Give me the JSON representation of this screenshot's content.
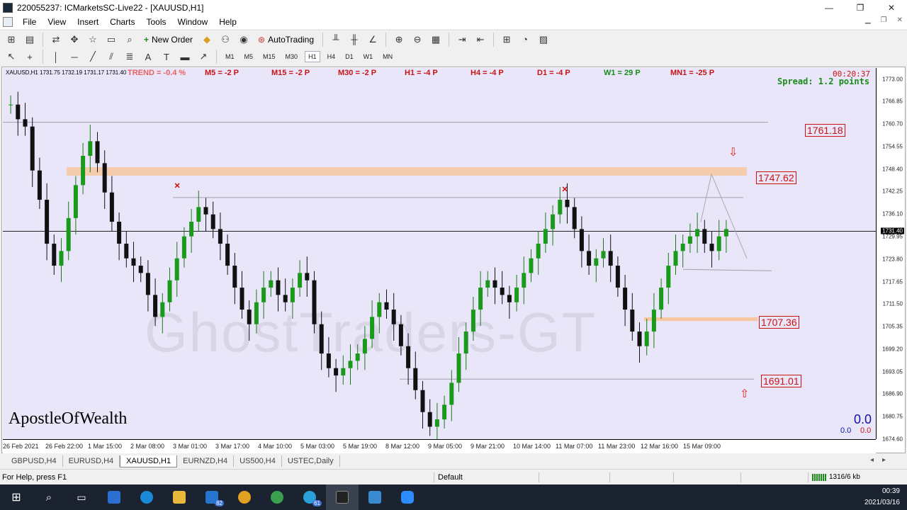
{
  "window": {
    "title": "220055237: ICMarketsSC-Live22 - [XAUUSD,H1]",
    "controls": [
      "—",
      "❐",
      "✕"
    ]
  },
  "menu": [
    "File",
    "View",
    "Insert",
    "Charts",
    "Tools",
    "Window",
    "Help"
  ],
  "toolbar": {
    "new_order": "New Order",
    "auto_trading": "AutoTrading",
    "timeframes": [
      "M1",
      "M5",
      "M15",
      "M30",
      "H1",
      "H4",
      "D1",
      "W1",
      "MN"
    ],
    "active_timeframe": "H1"
  },
  "chart": {
    "symbol_header": "XAUUSD,H1  1731.75 1732.19 1731.17 1731.40",
    "percent_info": "TREND = -0.4 %",
    "period_points": [
      {
        "label": "M5 = -2 P",
        "color": "#c81414"
      },
      {
        "label": "M15 = -2 P",
        "color": "#c81414"
      },
      {
        "label": "M30 = -2 P",
        "color": "#c81414"
      },
      {
        "label": "H1 = -4 P",
        "color": "#c81414"
      },
      {
        "label": "H4 = -4 P",
        "color": "#c81414"
      },
      {
        "label": "D1 = -4 P",
        "color": "#c81414"
      },
      {
        "label": "W1 = 29 P",
        "color": "#1a8a1a"
      },
      {
        "label": "MN1 = -25 P",
        "color": "#c81414"
      }
    ],
    "timer": "00:20:37",
    "spread": "Spread: 1.2 points",
    "current_price": "1731.40",
    "levels": [
      "1761.18",
      "1747.62",
      "1707.36",
      "1691.01"
    ],
    "brand": "ApostleOfWealth",
    "watermark": "GhostTraders-GT",
    "pnl_main": "0.0",
    "pnl_left": "0.0",
    "pnl_right": "0.0",
    "price_scale": [
      "1773.00",
      "1766.85",
      "1760.70",
      "1754.55",
      "1748.40",
      "1742.25",
      "1736.10",
      "1729.95",
      "1723.80",
      "1717.65",
      "1711.50",
      "1705.35",
      "1699.20",
      "1693.05",
      "1686.90",
      "1680.75",
      "1674.60"
    ],
    "time_scale": [
      "26 Feb 2021",
      "26 Feb 22:00",
      "1 Mar 15:00",
      "2 Mar 08:00",
      "3 Mar 01:00",
      "3 Mar 17:00",
      "4 Mar 10:00",
      "5 Mar 03:00",
      "5 Mar 19:00",
      "8 Mar 12:00",
      "9 Mar 05:00",
      "9 Mar 21:00",
      "10 Mar 14:00",
      "11 Mar 07:00",
      "11 Mar 23:00",
      "12 Mar 16:00",
      "15 Mar 09:00"
    ]
  },
  "tabs": [
    "GBPUSD,H4",
    "EURUSD,H4",
    "XAUUSD,H1",
    "EURNZD,H4",
    "US500,H4",
    "USTEC,Daily"
  ],
  "active_tab": "XAUUSD,H1",
  "status": {
    "help": "For Help, press F1",
    "profile": "Default",
    "connection": "1316/6 kb"
  },
  "taskbar": {
    "mail_badge": "82",
    "telegram_badge": "61",
    "time": "00:39",
    "date": "2021/03/16"
  },
  "chart_data": {
    "type": "candlestick",
    "symbol": "XAUUSD",
    "timeframe": "H1",
    "ylim": [
      1674.6,
      1776
    ],
    "close_series": [
      1766,
      1762,
      1760,
      1748,
      1740,
      1728,
      1722,
      1726,
      1735,
      1744,
      1752,
      1756,
      1750,
      1742,
      1734,
      1728,
      1724,
      1722,
      1720,
      1714,
      1708,
      1712,
      1718,
      1724,
      1730,
      1734,
      1738,
      1736,
      1732,
      1728,
      1722,
      1716,
      1710,
      1706,
      1712,
      1716,
      1718,
      1714,
      1712,
      1716,
      1720,
      1718,
      1706,
      1698,
      1694,
      1692,
      1694,
      1696,
      1698,
      1702,
      1708,
      1712,
      1710,
      1706,
      1700,
      1694,
      1688,
      1682,
      1678,
      1680,
      1684,
      1690,
      1698,
      1704,
      1710,
      1716,
      1718,
      1716,
      1714,
      1712,
      1716,
      1720,
      1724,
      1728,
      1732,
      1736,
      1740,
      1738,
      1732,
      1726,
      1722,
      1724,
      1726,
      1722,
      1716,
      1710,
      1704,
      1700,
      1704,
      1710,
      1716,
      1722,
      1726,
      1728,
      1730,
      1732,
      1728,
      1726,
      1730,
      1732
    ]
  }
}
